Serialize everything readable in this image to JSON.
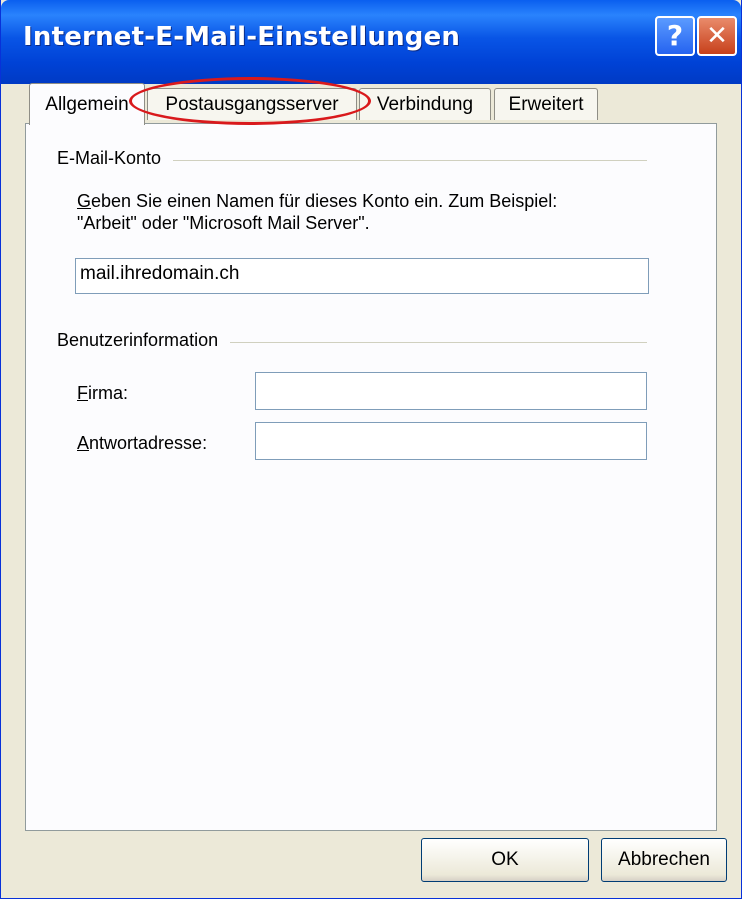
{
  "window": {
    "title": "Internet-E-Mail-Einstellungen",
    "help_glyph": "?",
    "close_glyph": "✕"
  },
  "tabs": [
    {
      "label": "Allgemein",
      "active": true
    },
    {
      "label": "Postausgangsserver",
      "active": false,
      "highlighted": true
    },
    {
      "label": "Verbindung",
      "active": false
    },
    {
      "label": "Erweitert",
      "active": false
    }
  ],
  "account_group": {
    "title": "E-Mail-Konto",
    "description_first_char": "G",
    "description_line1_rest": "eben Sie einen Namen für dieses Konto ein. Zum Beispiel:",
    "description_line2": "\"Arbeit\" oder \"Microsoft Mail Server\".",
    "account_name_value": "mail.ihredomain.ch"
  },
  "user_group": {
    "title": "Benutzerinformation",
    "company_label_first": "F",
    "company_label_rest": "irma:",
    "company_value": "",
    "reply_label_first": "A",
    "reply_label_rest": "ntwortadresse:",
    "reply_value": ""
  },
  "buttons": {
    "ok_label": "OK",
    "cancel_label": "Abbrechen"
  },
  "colors": {
    "titlebar": "#0054e3",
    "highlight_ellipse": "#d9191c",
    "dialog_face": "#ece9d8"
  }
}
